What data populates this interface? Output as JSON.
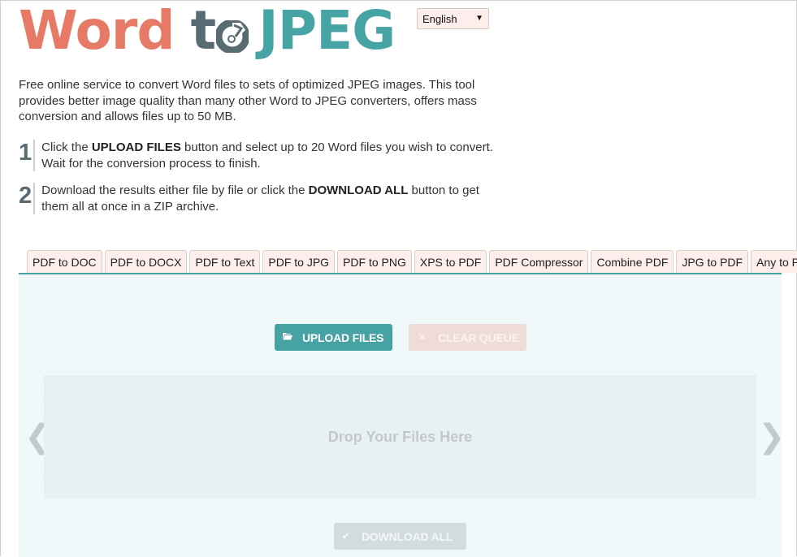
{
  "logo": {
    "word": "Word",
    "to_t": "t",
    "jpeg": "JPEG"
  },
  "language": {
    "selected": "English",
    "chevron": "⌄"
  },
  "intro": "Free online service to convert Word files to sets of optimized JPEG images. This tool provides better image quality than many other Word to JPEG converters, offers mass conversion and allows files up to 50 MB.",
  "steps": [
    {
      "num": "1",
      "pre": "Click the ",
      "bold": "UPLOAD FILES",
      "post": " button and select up to 20 Word files you wish to convert. Wait for the conversion process to finish."
    },
    {
      "num": "2",
      "pre": "Download the results either file by file or click the ",
      "bold": "DOWNLOAD ALL",
      "post": " button to get them all at once in a ZIP archive."
    }
  ],
  "tabs": [
    "PDF to DOC",
    "PDF to DOCX",
    "PDF to Text",
    "PDF to JPG",
    "PDF to PNG",
    "XPS to PDF",
    "PDF Compressor",
    "Combine PDF",
    "JPG to PDF",
    "Any to PDF"
  ],
  "buttons": {
    "upload": "UPLOAD FILES",
    "clear": "CLEAR QUEUE",
    "download": "DOWNLOAD ALL"
  },
  "icons": {
    "upload": "folder-open-icon",
    "clear": "x-icon",
    "download": "check-icon"
  },
  "dropzone": "Drop Your Files Here",
  "nav": {
    "prev": "❮",
    "next": "❯"
  },
  "colors": {
    "brand_orange": "#e67a66",
    "brand_slate": "#586a72",
    "brand_teal": "#46a4a4"
  }
}
